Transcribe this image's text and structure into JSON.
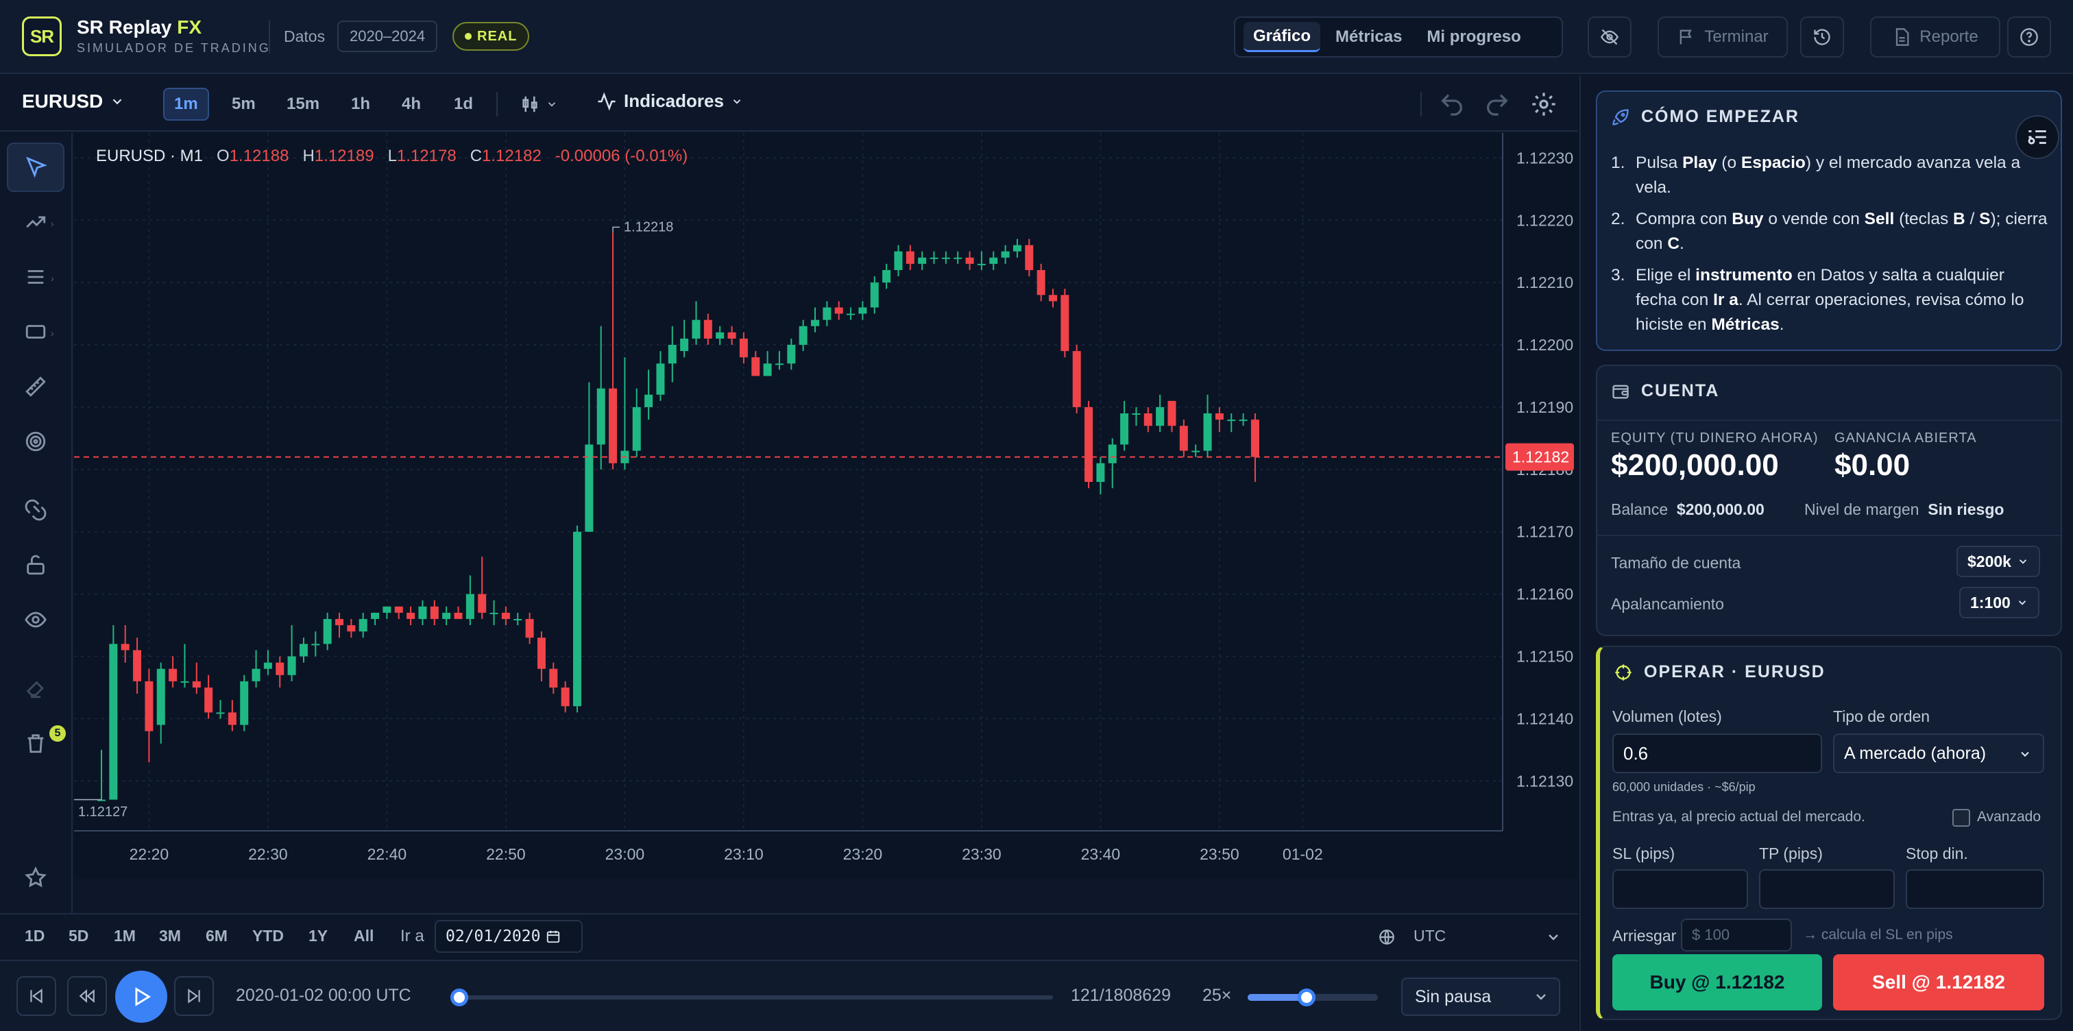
{
  "brand": {
    "name": "SR Replay",
    "name_fx": "FX",
    "subtitle": "SIMULADOR DE TRADING",
    "logo_text": "SR"
  },
  "header": {
    "datos_label": "Datos",
    "datos_range": "2020–2024",
    "mode_badge": "REAL",
    "tabs": [
      "Gráfico",
      "Métricas",
      "Mi progreso"
    ],
    "active_tab": "Gráfico",
    "terminate_label": "Terminar",
    "report_label": "Reporte"
  },
  "toolbar": {
    "symbol": "EURUSD",
    "timeframes": [
      "1m",
      "5m",
      "15m",
      "1h",
      "4h",
      "1d"
    ],
    "active_timeframe": "1m",
    "indicators_label": "Indicadores"
  },
  "left_tools": {
    "trash_badge": "5"
  },
  "ohlc": {
    "title": "EURUSD · M1",
    "o_label": "O",
    "o": "1.12188",
    "h_label": "H",
    "h": "1.12189",
    "l_label": "L",
    "l": "1.12178",
    "c_label": "C",
    "c": "1.12182",
    "change": "-0.00006 (-0.01%)"
  },
  "chart_data": {
    "type": "candlestick",
    "symbol": "EURUSD",
    "timeframe": "M1",
    "ylim": [
      1.12122,
      1.12234
    ],
    "y_ticks": [
      "1.12230",
      "1.12220",
      "1.12210",
      "1.12200",
      "1.12190",
      "1.12180",
      "1.12170",
      "1.12160",
      "1.12150",
      "1.12140",
      "1.12130"
    ],
    "x_ticks": [
      "22:20",
      "22:30",
      "22:40",
      "22:50",
      "23:00",
      "23:10",
      "23:20",
      "23:30",
      "23:40",
      "23:50",
      "01-02"
    ],
    "current_price": "1.12182",
    "high_annotation": "1.12218",
    "low_annotation": "1.12127",
    "candles": [
      [
        1.12127,
        1.12127,
        1.12135,
        1.12127
      ],
      [
        1.12127,
        1.12152,
        1.12155,
        1.12127
      ],
      [
        1.12152,
        1.12151,
        1.12155,
        1.12149
      ],
      [
        1.12151,
        1.12146,
        1.12153,
        1.12144
      ],
      [
        1.12146,
        1.12138,
        1.12148,
        1.12133
      ],
      [
        1.12139,
        1.12148,
        1.12149,
        1.12136
      ],
      [
        1.12148,
        1.12146,
        1.1215,
        1.12145
      ],
      [
        1.12146,
        1.12146,
        1.12152,
        1.12145
      ],
      [
        1.12146,
        1.12145,
        1.12149,
        1.12144
      ],
      [
        1.12145,
        1.12141,
        1.12147,
        1.1214
      ],
      [
        1.12141,
        1.12141,
        1.12143,
        1.1214
      ],
      [
        1.12141,
        1.12139,
        1.12143,
        1.12138
      ],
      [
        1.12139,
        1.12146,
        1.12147,
        1.12138
      ],
      [
        1.12146,
        1.12148,
        1.12151,
        1.12145
      ],
      [
        1.12148,
        1.12149,
        1.12151,
        1.12147
      ],
      [
        1.12149,
        1.12147,
        1.1215,
        1.12145
      ],
      [
        1.12147,
        1.1215,
        1.12155,
        1.12146
      ],
      [
        1.1215,
        1.12152,
        1.12153,
        1.12149
      ],
      [
        1.12152,
        1.12152,
        1.12154,
        1.1215
      ],
      [
        1.12152,
        1.12156,
        1.12157,
        1.12151
      ],
      [
        1.12156,
        1.12155,
        1.12157,
        1.12153
      ],
      [
        1.12155,
        1.12154,
        1.12156,
        1.12153
      ],
      [
        1.12154,
        1.12156,
        1.12157,
        1.12153
      ],
      [
        1.12156,
        1.12157,
        1.12157,
        1.12155
      ],
      [
        1.12157,
        1.12158,
        1.12158,
        1.12156
      ],
      [
        1.12158,
        1.12157,
        1.12158,
        1.12156
      ],
      [
        1.12157,
        1.12156,
        1.12158,
        1.12155
      ],
      [
        1.12156,
        1.12158,
        1.12159,
        1.12155
      ],
      [
        1.12158,
        1.12156,
        1.12159,
        1.12155
      ],
      [
        1.12156,
        1.12157,
        1.12158,
        1.12155
      ],
      [
        1.12157,
        1.12156,
        1.12158,
        1.12156
      ],
      [
        1.12156,
        1.1216,
        1.12163,
        1.12155
      ],
      [
        1.1216,
        1.12157,
        1.12166,
        1.12156
      ],
      [
        1.12157,
        1.12157,
        1.12159,
        1.12155
      ],
      [
        1.12157,
        1.12156,
        1.12158,
        1.12155
      ],
      [
        1.12156,
        1.12156,
        1.12157,
        1.12155
      ],
      [
        1.12156,
        1.12153,
        1.12157,
        1.12152
      ],
      [
        1.12153,
        1.12148,
        1.12154,
        1.12146
      ],
      [
        1.12148,
        1.12145,
        1.12149,
        1.12144
      ],
      [
        1.12145,
        1.12142,
        1.12146,
        1.12141
      ],
      [
        1.12142,
        1.1217,
        1.12171,
        1.12141
      ],
      [
        1.1217,
        1.12184,
        1.12194,
        1.1217
      ],
      [
        1.12184,
        1.12193,
        1.12203,
        1.1218
      ],
      [
        1.12193,
        1.12181,
        1.12218,
        1.1218
      ],
      [
        1.12181,
        1.12183,
        1.12198,
        1.1218
      ],
      [
        1.12183,
        1.1219,
        1.12193,
        1.12182
      ],
      [
        1.1219,
        1.12192,
        1.12196,
        1.12188
      ],
      [
        1.12192,
        1.12197,
        1.12199,
        1.12191
      ],
      [
        1.12197,
        1.122,
        1.12203,
        1.12194
      ],
      [
        1.12199,
        1.12201,
        1.12204,
        1.12198
      ],
      [
        1.12201,
        1.12204,
        1.12207,
        1.122
      ],
      [
        1.12204,
        1.12201,
        1.12205,
        1.122
      ],
      [
        1.12201,
        1.12202,
        1.12203,
        1.122
      ],
      [
        1.12202,
        1.12201,
        1.12203,
        1.122
      ],
      [
        1.12201,
        1.12198,
        1.12202,
        1.12197
      ],
      [
        1.12198,
        1.12195,
        1.12199,
        1.12195
      ],
      [
        1.12195,
        1.12197,
        1.12199,
        1.12195
      ],
      [
        1.12197,
        1.12197,
        1.12199,
        1.12196
      ],
      [
        1.12197,
        1.122,
        1.12201,
        1.12196
      ],
      [
        1.122,
        1.12203,
        1.12204,
        1.12199
      ],
      [
        1.12203,
        1.12204,
        1.12206,
        1.12202
      ],
      [
        1.12204,
        1.12206,
        1.12207,
        1.12203
      ],
      [
        1.12206,
        1.12205,
        1.12207,
        1.12204
      ],
      [
        1.12205,
        1.12205,
        1.12206,
        1.12204
      ],
      [
        1.12205,
        1.12206,
        1.12207,
        1.12204
      ],
      [
        1.12206,
        1.1221,
        1.12211,
        1.12205
      ],
      [
        1.1221,
        1.12212,
        1.12213,
        1.12209
      ],
      [
        1.12212,
        1.12215,
        1.12216,
        1.12211
      ],
      [
        1.12215,
        1.12213,
        1.12216,
        1.12212
      ],
      [
        1.12213,
        1.12214,
        1.12215,
        1.12212
      ],
      [
        1.12214,
        1.12214,
        1.12215,
        1.12213
      ],
      [
        1.12214,
        1.12214,
        1.12215,
        1.12213
      ],
      [
        1.12214,
        1.12214,
        1.12215,
        1.12213
      ],
      [
        1.12214,
        1.12213,
        1.12215,
        1.12212
      ],
      [
        1.12213,
        1.12213,
        1.12215,
        1.12212
      ],
      [
        1.12213,
        1.12214,
        1.12215,
        1.12212
      ],
      [
        1.12214,
        1.12215,
        1.12216,
        1.12213
      ],
      [
        1.12215,
        1.12216,
        1.12217,
        1.12214
      ],
      [
        1.12216,
        1.12212,
        1.12217,
        1.12211
      ],
      [
        1.12212,
        1.12208,
        1.12213,
        1.12207
      ],
      [
        1.12208,
        1.12207,
        1.12209,
        1.12206
      ],
      [
        1.12208,
        1.12199,
        1.12209,
        1.12198
      ],
      [
        1.12199,
        1.1219,
        1.122,
        1.12189
      ],
      [
        1.1219,
        1.12178,
        1.12191,
        1.12177
      ],
      [
        1.12178,
        1.12181,
        1.12182,
        1.12176
      ],
      [
        1.12181,
        1.12184,
        1.12185,
        1.12177
      ],
      [
        1.12184,
        1.12189,
        1.12191,
        1.12183
      ],
      [
        1.12189,
        1.12189,
        1.1219,
        1.12187
      ],
      [
        1.12189,
        1.12187,
        1.1219,
        1.12186
      ],
      [
        1.12187,
        1.1219,
        1.12192,
        1.12186
      ],
      [
        1.12191,
        1.12187,
        1.12191,
        1.12186
      ],
      [
        1.12187,
        1.12183,
        1.12188,
        1.12182
      ],
      [
        1.12183,
        1.12183,
        1.12184,
        1.12182
      ],
      [
        1.12183,
        1.12189,
        1.12192,
        1.12182
      ],
      [
        1.12189,
        1.12188,
        1.1219,
        1.12186
      ],
      [
        1.12188,
        1.12188,
        1.12189,
        1.12186
      ],
      [
        1.12188,
        1.12188,
        1.12189,
        1.12187
      ],
      [
        1.12188,
        1.12182,
        1.12189,
        1.12178
      ]
    ]
  },
  "range_bar": {
    "ranges": [
      "1D",
      "5D",
      "1M",
      "3M",
      "6M",
      "YTD",
      "1Y",
      "All"
    ],
    "goto_label": "Ir a",
    "goto_date": "02/01/2020",
    "timezone": "UTC"
  },
  "player": {
    "time": "2020-01-02 00:00 UTC",
    "counter": "121/1808629",
    "progress": 0.0001,
    "speed_label": "25×",
    "speed_fraction": 0.45,
    "pause_option": "Sin pausa"
  },
  "getting_started": {
    "title": "CÓMO EMPEZAR",
    "s1_a": "Pulsa ",
    "s1_b": "Play",
    "s1_c": " (o ",
    "s1_d": "Espacio",
    "s1_e": ") y el mercado avanza vela a vela.",
    "s2_a": "Compra con ",
    "s2_b": "Buy",
    "s2_c": " o vende con ",
    "s2_d": "Sell",
    "s2_e": " (teclas ",
    "s2_f": "B",
    "s2_g": " / ",
    "s2_h": "S",
    "s2_i": "); cierra con ",
    "s2_j": "C",
    "s2_k": ".",
    "s3_a": "Elige el ",
    "s3_b": "instrumento",
    "s3_c": " en Datos y salta a cualquier fecha con ",
    "s3_d": "Ir a",
    "s3_e": ". Al cerrar operaciones, revisa cómo lo hiciste en ",
    "s3_f": "Métricas",
    "s3_g": "."
  },
  "account": {
    "title": "CUENTA",
    "equity_label": "EQUITY (TU DINERO AHORA)",
    "equity_value": "$200,000.00",
    "open_gain_label": "GANANCIA ABIERTA",
    "open_gain_value": "$0.00",
    "balance_label": "Balance",
    "balance_value": "$200,000.00",
    "margin_label": "Nivel de margen",
    "margin_value": "Sin riesgo",
    "size_label": "Tamaño de cuenta",
    "size_value": "$200k",
    "leverage_label": "Apalancamiento",
    "leverage_value": "1:100"
  },
  "trade": {
    "title": "OPERAR · EURUSD",
    "volume_label": "Volumen (lotes)",
    "volume_value": "0.6",
    "volume_hint": "60,000 unidades · ~$6/pip",
    "order_type_label": "Tipo de orden",
    "order_type_value": "A mercado (ahora)",
    "order_hint": "Entras ya, al precio actual del mercado.",
    "advanced_label": "Avanzado",
    "sl_label": "SL (pips)",
    "tp_label": "TP (pips)",
    "stop_label": "Stop din.",
    "risk_label": "Arriesgar",
    "risk_placeholder": "$ 100",
    "risk_hint": "→ calcula el SL en pips",
    "buy_label": "Buy @ 1.12182",
    "sell_label": "Sell @ 1.12182"
  },
  "colors": {
    "up": "#1fb884",
    "down": "#f0434a",
    "accent": "#3b82f6",
    "brand": "#d6f15a"
  }
}
